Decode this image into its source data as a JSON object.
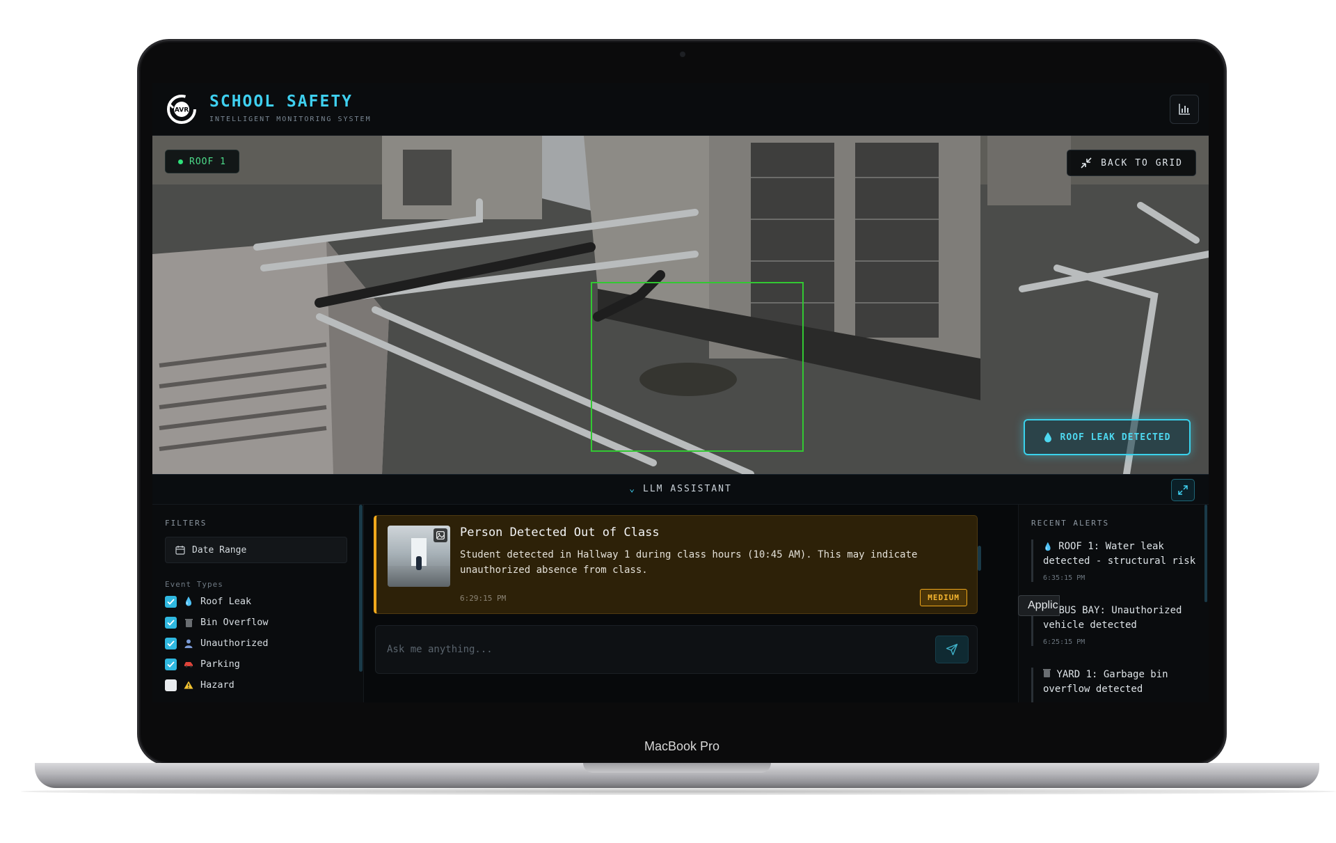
{
  "device": {
    "label": "MacBook Pro"
  },
  "header": {
    "title": "SCHOOL SAFETY",
    "subtitle": "INTELLIGENT MONITORING SYSTEM",
    "logo_text": "AVR",
    "stats_icon": "bar-chart-icon"
  },
  "camera": {
    "name": "ROOF 1",
    "back_label": "BACK TO GRID",
    "detection_label": "ROOF LEAK DETECTED",
    "detection_color": "#3ad2ec",
    "box_color": "#32c832"
  },
  "assistant": {
    "label": "LLM ASSISTANT"
  },
  "filters": {
    "heading": "FILTERS",
    "date_range": "Date Range",
    "event_types_heading": "Event Types",
    "events": [
      {
        "label": "Roof Leak",
        "checked": true,
        "icon": "droplet-icon"
      },
      {
        "label": "Bin Overflow",
        "checked": true,
        "icon": "trash-icon"
      },
      {
        "label": "Unauthorized",
        "checked": true,
        "icon": "person-icon"
      },
      {
        "label": "Parking",
        "checked": true,
        "icon": "car-icon"
      },
      {
        "label": "Hazard",
        "checked": false,
        "icon": "warning-icon"
      }
    ]
  },
  "alert_card": {
    "title": "Person Detected Out of Class",
    "body": "Student detected in Hallway 1 during class hours (10:45 AM). This may indicate unauthorized absence from class.",
    "time": "6:29:15 PM",
    "severity": "MEDIUM",
    "accent": "#f0a81c"
  },
  "chat": {
    "placeholder": "Ask me anything..."
  },
  "recent_alerts": {
    "heading": "RECENT ALERTS",
    "items": [
      {
        "icon": "droplet-icon",
        "text": "ROOF 1: Water leak detected - structural risk",
        "time": "6:35:15 PM"
      },
      {
        "icon": "car-icon",
        "text": "BUS BAY: Unauthorized vehicle detected",
        "time": "6:25:15 PM"
      },
      {
        "icon": "trash-icon",
        "text": "YARD 1: Garbage bin overflow detected",
        "time": ""
      }
    ]
  },
  "overlay_tag": "Applic"
}
